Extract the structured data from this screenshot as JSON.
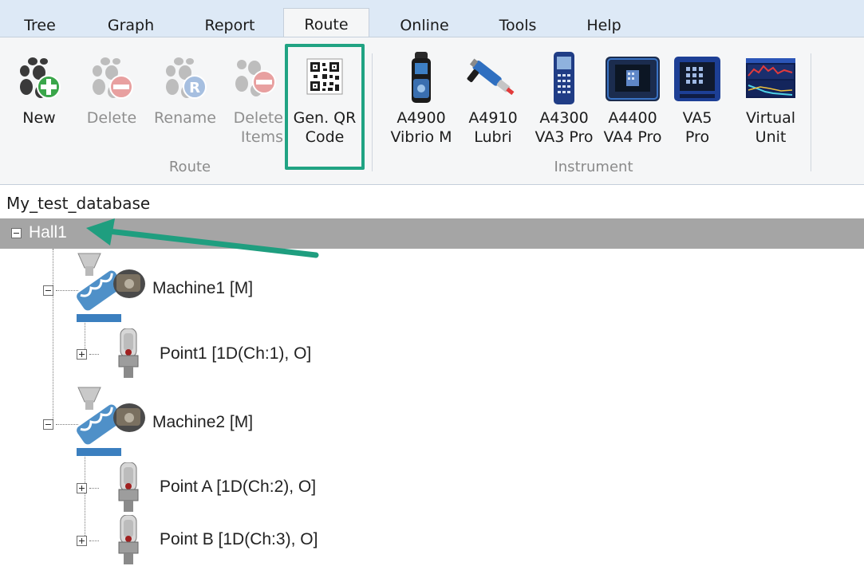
{
  "tabs": [
    "Tree",
    "Graph",
    "Report",
    "Route",
    "Online",
    "Tools",
    "Help"
  ],
  "ribbon": {
    "route_buttons": [
      {
        "label": "New",
        "icon": "new-route-icon",
        "enabled": true
      },
      {
        "label": "Delete",
        "icon": "delete-route-icon",
        "enabled": false
      },
      {
        "label": "Rename",
        "icon": "rename-route-icon",
        "enabled": false
      },
      {
        "label": "Delete\nItems",
        "icon": "delete-items-icon",
        "enabled": false
      },
      {
        "label": "Gen. QR\nCode",
        "icon": "qr-code-icon",
        "enabled": true
      }
    ],
    "route_group_label": "Route",
    "instrument_buttons": [
      {
        "label": "A4900\nVibrio M",
        "icon": "vibrio-m-device-icon"
      },
      {
        "label": "A4910\nLubri",
        "icon": "lubri-device-icon"
      },
      {
        "label": "A4300\nVA3 Pro",
        "icon": "va3-pro-device-icon"
      },
      {
        "label": "A4400\nVA4 Pro",
        "icon": "va4-pro-device-icon"
      },
      {
        "label": "VA5\nPro",
        "icon": "va5-pro-device-icon"
      },
      {
        "label": "Virtual\nUnit",
        "icon": "virtual-unit-icon"
      }
    ],
    "instrument_group_label": "Instrument"
  },
  "tree": {
    "database": "My_test_database",
    "root": "Hall1",
    "machines": [
      {
        "label": "Machine1 [M]",
        "points": [
          "Point1 [1D(Ch:1), O]"
        ]
      },
      {
        "label": "Machine2 [M]",
        "points": [
          "Point A [1D(Ch:2), O]",
          "Point B [1D(Ch:3), O]"
        ]
      }
    ]
  },
  "colors": {
    "highlight": "#20a383",
    "arrow": "#1f9e7f",
    "tab_bar": "#dde9f6",
    "selected_row": "#a5a5a5"
  }
}
